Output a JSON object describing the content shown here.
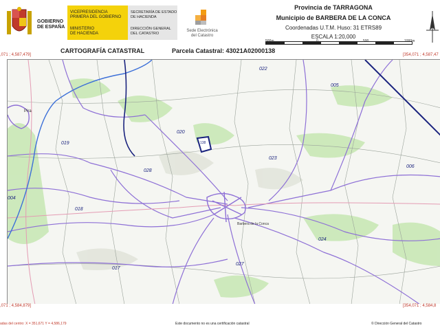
{
  "header": {
    "gov_line1": "GOBIERNO",
    "gov_line2": "DE ESPAÑA",
    "vice_line1": "VICEPRESIDENCIA",
    "vice_line2": "PRIMERA DEL GOBIERNO",
    "min_line1": "MINISTERIO",
    "min_line2": "DE HACIENDA",
    "sec_line1": "SECRETARÍA DE ESTADO",
    "sec_line2": "DE HACIENDA",
    "dir_line1": "DIRECCIÓN GENERAL",
    "dir_line2": "DEL CATASTRO",
    "sede_line1": "Sede Electrónica",
    "sede_line2": "del Catastro",
    "province": "Provincia de TARRAGONA",
    "municipality": "Municipio de BARBERA DE LA CONCA",
    "coordinates": "Coordenadas U.T.M. Huso: 31 ETRS89",
    "scale": "ESCALA 1:20,000",
    "scale_labels": [
      "500m",
      "0",
      "500",
      "1000m"
    ]
  },
  "title_row": {
    "title": "CARTOGRAFÍA CATASTRAL",
    "parcel": "Parcela Catastral: 43021A02000138",
    "top_left_coord": ",071 ; 4,587,479]",
    "top_right_coord": "[354,071 ; 4,587,47"
  },
  "map": {
    "polygon_labels": [
      "022",
      "005",
      "020",
      "019",
      "028",
      "023",
      "006",
      "018",
      "004",
      "024",
      "017",
      "027"
    ],
    "parcel_label": "138",
    "place_labels": [
      "Pira",
      "Barbera de la Conca"
    ],
    "bottom_left_coord": ",071 ; 4,584,879]",
    "bottom_right_coord": "[354,071 ; 4,584,8"
  },
  "footer": {
    "center_coords": "adas del centro: X = 351,671 Y = 4,586,179",
    "disclaimer": "Este documento no es una certificación catastral",
    "copyright": "© Dirección General del Catastro"
  },
  "colors": {
    "gov_yellow": "#f4d20b",
    "coord_red": "#c0392b",
    "road_purple": "#8d6fd6",
    "boundary_blue": "#1a237e",
    "river_blue": "#3b6fd8",
    "vegetation_green": "#b8e3a4"
  }
}
